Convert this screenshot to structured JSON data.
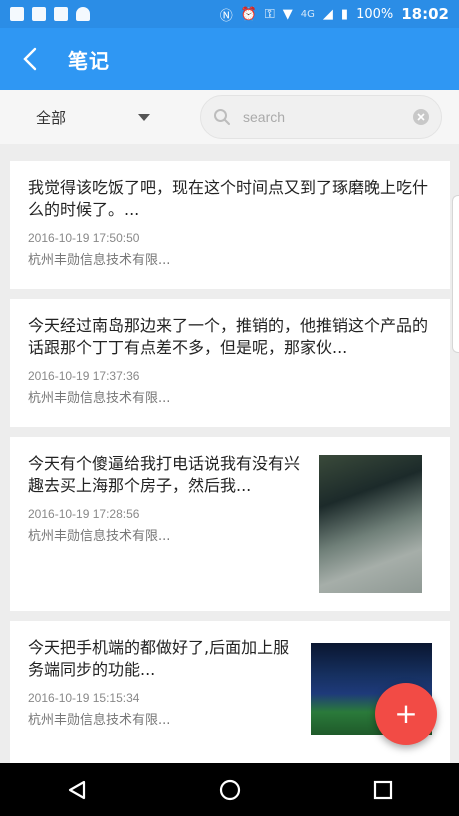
{
  "status_bar": {
    "network": "4G",
    "battery": "100%",
    "time": "18:02"
  },
  "app_bar": {
    "title": "笔记"
  },
  "filter": {
    "dropdown_value": "全部",
    "search_placeholder": "search"
  },
  "notes": [
    {
      "title": "我觉得该吃饭了吧，现在这个时间点又到了琢磨晚上吃什么的时候了。...",
      "time": "2016-10-19 17:50:50",
      "company": "杭州丰勋信息技术有限..."
    },
    {
      "title": "今天经过南岛那边来了一个，推销的，他推销这个产品的话跟那个丁丁有点差不多，但是呢，那家伙...",
      "time": "2016-10-19 17:37:36",
      "company": "杭州丰勋信息技术有限..."
    },
    {
      "title": "今天有个傻逼给我打电话说我有没有兴趣去买上海那个房子，然后我...",
      "time": "2016-10-19 17:28:56",
      "company": "杭州丰勋信息技术有限..."
    },
    {
      "title": "今天把手机端的都做好了,后面加上服务端同步的功能...",
      "time": "2016-10-19 15:15:34",
      "company": "杭州丰勋信息技术有限..."
    }
  ],
  "fab": {
    "label": "+"
  },
  "colors": {
    "primary": "#2f97f3",
    "status_bar": "#2b8de6",
    "fab": "#f24b45"
  }
}
